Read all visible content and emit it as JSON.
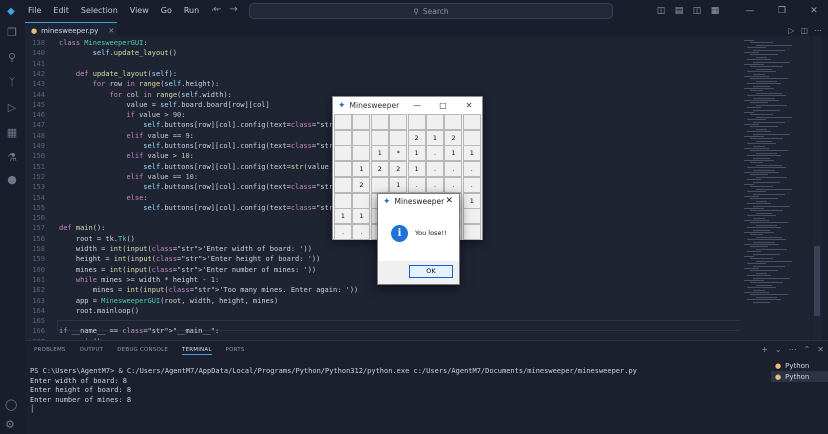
{
  "titlebar": {
    "menu": [
      "File",
      "Edit",
      "Selection",
      "View",
      "Go",
      "Run",
      "···"
    ],
    "search_placeholder": "Search"
  },
  "editor": {
    "tab_label": "minesweeper.py",
    "lines": [
      {
        "n": "138",
        "t": "class MinesweeperGUI:"
      },
      {
        "n": "140",
        "t": "        self.update_layout()"
      },
      {
        "n": "141",
        "t": ""
      },
      {
        "n": "142",
        "t": "    def update_layout(self):"
      },
      {
        "n": "143",
        "t": "        for row in range(self.height):"
      },
      {
        "n": "144",
        "t": "            for col in range(self.width):"
      },
      {
        "n": "145",
        "t": "                value = self.board.board[row][col]"
      },
      {
        "n": "146",
        "t": "                if value > 90:"
      },
      {
        "n": "147",
        "t": "                    self.buttons[row][col].config(text='F', state='dis"
      },
      {
        "n": "148",
        "t": "                elif value == 9:"
      },
      {
        "n": "149",
        "t": "                    self.buttons[row][col].config(text='*', state='dis"
      },
      {
        "n": "150",
        "t": "                elif value > 10:"
      },
      {
        "n": "151",
        "t": "                    self.buttons[row][col].config(text=str(value - 10)"
      },
      {
        "n": "152",
        "t": "                elif value == 10:"
      },
      {
        "n": "153",
        "t": "                    self.buttons[row][col].config(text='.', state='dis"
      },
      {
        "n": "154",
        "t": "                else:"
      },
      {
        "n": "155",
        "t": "                    self.buttons[row][col].config(text='', state='norm"
      },
      {
        "n": "156",
        "t": ""
      },
      {
        "n": "157",
        "t": "def main():"
      },
      {
        "n": "156",
        "t": "    root = tk.Tk()"
      },
      {
        "n": "158",
        "t": "    width = int(input('Enter width of board: '))"
      },
      {
        "n": "159",
        "t": "    height = int(input('Enter height of board: '))"
      },
      {
        "n": "160",
        "t": "    mines = int(input('Enter number of mines: '))"
      },
      {
        "n": "161",
        "t": "    while mines >= width * height - 1:"
      },
      {
        "n": "162",
        "t": "        mines = int(input('Too many mines. Enter again: '))"
      },
      {
        "n": "163",
        "t": "    app = MinesweeperGUI(root, width, height, mines)"
      },
      {
        "n": "164",
        "t": "    root.mainloop()"
      },
      {
        "n": "165",
        "t": ""
      },
      {
        "n": "166",
        "t": "if __name__ == \"__main__\":"
      },
      {
        "n": "167",
        "t": "    main()"
      },
      {
        "n": "168",
        "t": ""
      }
    ]
  },
  "panel": {
    "tabs": [
      "PROBLEMS",
      "OUTPUT",
      "DEBUG CONSOLE",
      "TERMINAL",
      "PORTS"
    ],
    "active_tab": "TERMINAL",
    "terminal_lines": [
      "PS C:\\Users\\AgentM7> & C:/Users/AgentM7/AppData/Local/Programs/Python/Python312/python.exe c:/Users/AgentM7/Documents/minesweeper/minesweeper.py",
      "Enter width of board: 8",
      "Enter height of board: 8",
      "Enter number of mines: 8",
      "│"
    ],
    "terminals": [
      "Python",
      "Python"
    ]
  },
  "minesweeper_window": {
    "title": "Minesweeper",
    "cells": [
      [
        "",
        "",
        "",
        "",
        "",
        "",
        "",
        ""
      ],
      [
        "",
        "",
        "",
        "",
        "2",
        "1",
        "2",
        ""
      ],
      [
        "",
        "",
        "1",
        "*",
        "1",
        ".",
        "1",
        "1"
      ],
      [
        "",
        "1",
        "2",
        "2",
        "1",
        ".",
        ".",
        "."
      ],
      [
        "",
        "2",
        "",
        "1",
        ".",
        ".",
        ".",
        "."
      ],
      [
        "",
        "",
        "",
        "",
        "",
        ".",
        "1",
        "1"
      ],
      [
        "1",
        "1",
        "",
        "",
        "",
        "",
        "",
        ""
      ],
      [
        ".",
        ".",
        "",
        "",
        "",
        "",
        "",
        ""
      ]
    ]
  },
  "dialog": {
    "title": "Minesweeper",
    "message": "You lose!!",
    "ok_label": "OK"
  }
}
